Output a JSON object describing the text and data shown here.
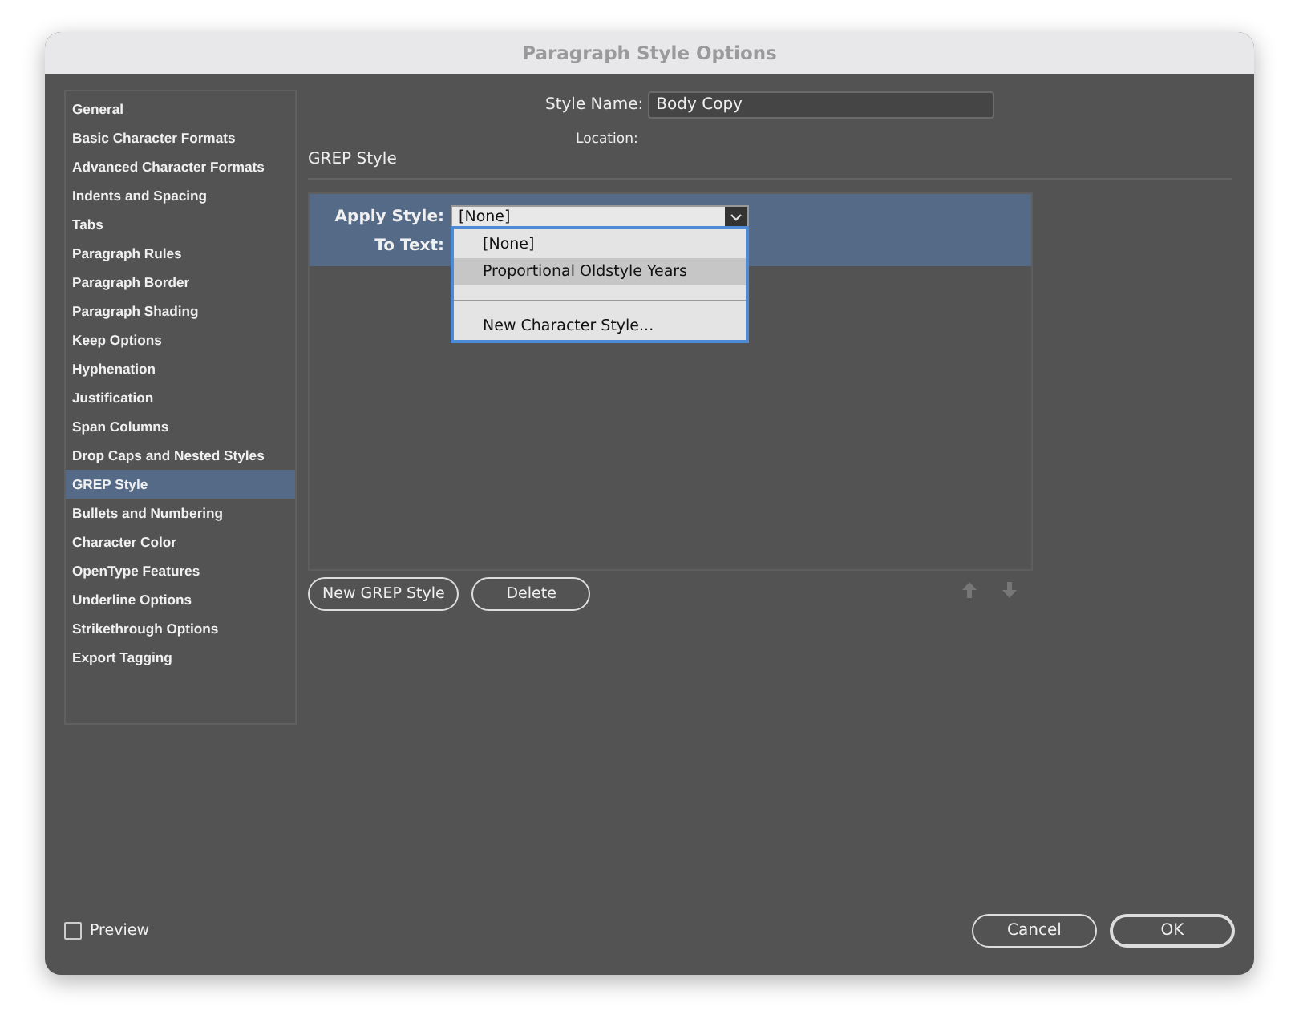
{
  "window": {
    "title": "Paragraph Style Options"
  },
  "sidebar": {
    "items": [
      {
        "label": "General",
        "selected": false
      },
      {
        "label": "Basic Character Formats",
        "selected": false
      },
      {
        "label": "Advanced Character Formats",
        "selected": false
      },
      {
        "label": "Indents and Spacing",
        "selected": false
      },
      {
        "label": "Tabs",
        "selected": false
      },
      {
        "label": "Paragraph Rules",
        "selected": false
      },
      {
        "label": "Paragraph Border",
        "selected": false
      },
      {
        "label": "Paragraph Shading",
        "selected": false
      },
      {
        "label": "Keep Options",
        "selected": false
      },
      {
        "label": "Hyphenation",
        "selected": false
      },
      {
        "label": "Justification",
        "selected": false
      },
      {
        "label": "Span Columns",
        "selected": false
      },
      {
        "label": "Drop Caps and Nested Styles",
        "selected": false
      },
      {
        "label": "GREP Style",
        "selected": true
      },
      {
        "label": "Bullets and Numbering",
        "selected": false
      },
      {
        "label": "Character Color",
        "selected": false
      },
      {
        "label": "OpenType Features",
        "selected": false
      },
      {
        "label": "Underline Options",
        "selected": false
      },
      {
        "label": "Strikethrough Options",
        "selected": false
      },
      {
        "label": "Export Tagging",
        "selected": false
      }
    ]
  },
  "style_name": {
    "label": "Style Name:",
    "value": "Body Copy"
  },
  "location": {
    "label": "Location:"
  },
  "section_title": "GREP Style",
  "grep_rule": {
    "apply_style_label": "Apply Style:",
    "apply_style_value": "[None]",
    "to_text_label": "To Text:",
    "selected": true
  },
  "dropdown_menu": {
    "items": [
      {
        "kind": "option",
        "label": "[None]",
        "selected": false
      },
      {
        "kind": "option",
        "label": "Proportional Oldstyle Years",
        "selected": true
      },
      {
        "kind": "separator"
      },
      {
        "kind": "option",
        "label": "New Character Style...",
        "selected": false
      }
    ]
  },
  "buttons": {
    "new_grep_style": "New GREP Style",
    "delete": "Delete"
  },
  "preview": {
    "label": "Preview",
    "checked": false
  },
  "footer_buttons": [
    {
      "label": "Cancel",
      "default": false
    },
    {
      "label": "OK",
      "default": true
    }
  ]
}
